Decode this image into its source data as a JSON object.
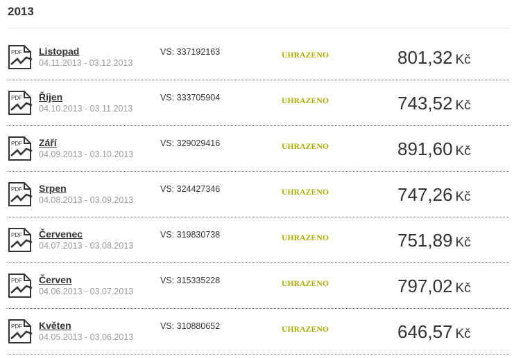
{
  "year": "2013",
  "colors": {
    "status": "#a8ad00",
    "divider": "#666666",
    "muted_text": "#9a9a9a"
  },
  "invoices": [
    {
      "month": "Listopad",
      "period": "04.11.2013 - 03.12.2013",
      "vs": "VS: 337192163",
      "status": "UHRAZENO",
      "amount": "801,32",
      "currency": "Kč",
      "icon": "pdf-icon"
    },
    {
      "month": "Říjen",
      "period": "04.10.2013 - 03.11.2013",
      "vs": "VS: 333705904",
      "status": "UHRAZENO",
      "amount": "743,52",
      "currency": "Kč",
      "icon": "pdf-icon"
    },
    {
      "month": "Září",
      "period": "04.09.2013 - 03.10.2013",
      "vs": "VS: 329029416",
      "status": "UHRAZENO",
      "amount": "891,60",
      "currency": "Kč",
      "icon": "pdf-icon"
    },
    {
      "month": "Srpen",
      "period": "04.08.2013 - 03.09.2013",
      "vs": "VS: 324427346",
      "status": "UHRAZENO",
      "amount": "747,26",
      "currency": "Kč",
      "icon": "pdf-icon"
    },
    {
      "month": "Červenec",
      "period": "04.07.2013 - 03.08.2013",
      "vs": "VS: 319830738",
      "status": "UHRAZENO",
      "amount": "751,89",
      "currency": "Kč",
      "icon": "pdf-icon"
    },
    {
      "month": "Červen",
      "period": "04.06.2013 - 03.07.2013",
      "vs": "VS: 315335228",
      "status": "UHRAZENO",
      "amount": "797,02",
      "currency": "Kč",
      "icon": "pdf-icon"
    },
    {
      "month": "Květen",
      "period": "04.05.2013 - 03.06.2013",
      "vs": "VS: 310880652",
      "status": "UHRAZENO",
      "amount": "646,57",
      "currency": "Kč",
      "icon": "pdf-icon"
    }
  ]
}
